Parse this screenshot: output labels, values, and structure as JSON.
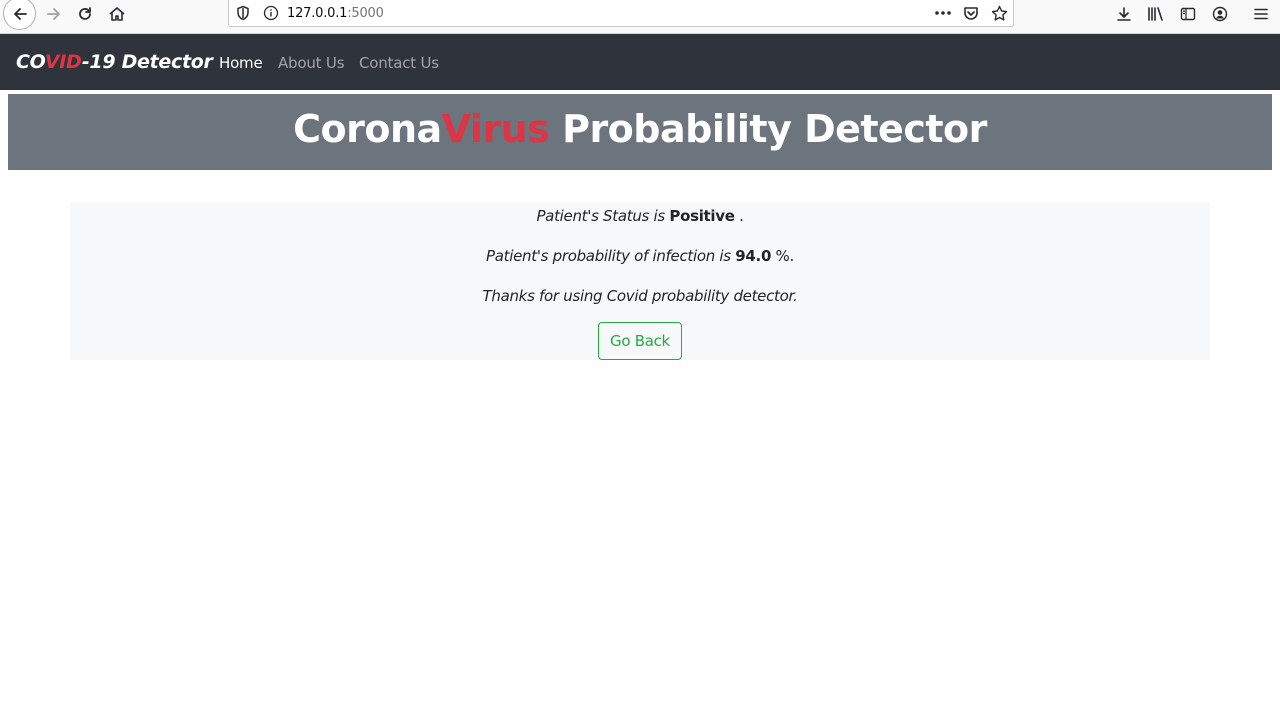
{
  "browser": {
    "url_host": "127.0.0.1",
    "url_port": ":5000"
  },
  "navbar": {
    "brand_part1": "CO",
    "brand_part2": "VID",
    "brand_part3": "-19 Detector",
    "links": [
      {
        "label": "Home",
        "active": true
      },
      {
        "label": "About Us",
        "active": false
      },
      {
        "label": "Contact Us",
        "active": false
      }
    ]
  },
  "hero": {
    "title_part1": "Corona",
    "title_part2": "Virus",
    "title_part3": " Probability Detector"
  },
  "result": {
    "status_prefix": "Patient's Status is ",
    "status_value": "Positive",
    "status_suffix": " .",
    "prob_prefix": "Patient's probability of infection is ",
    "prob_value": "94.0",
    "prob_suffix": " %.",
    "thanks": "Thanks for using Covid probability detector.",
    "go_back_label": "Go Back"
  },
  "colors": {
    "navbar_bg": "#2f333b",
    "hero_bg": "#6c757d",
    "accent_red": "#dc3545",
    "success_green": "#28a745",
    "panel_bg": "#f7f8f9"
  },
  "icons": [
    "back-arrow-icon",
    "forward-arrow-icon",
    "reload-icon",
    "home-icon",
    "shield-icon",
    "info-icon",
    "more-icon",
    "pocket-icon",
    "star-icon",
    "download-icon",
    "library-icon",
    "sidebar-icon",
    "account-icon",
    "menu-icon"
  ]
}
